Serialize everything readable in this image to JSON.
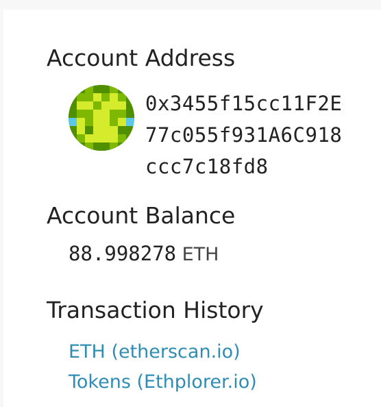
{
  "account_address": {
    "heading": "Account Address",
    "address_lines": [
      "0x3455f15cc11F2E",
      "77c055f931A6C918",
      "ccc7c18fd8"
    ],
    "identicon": {
      "icon": "identicon-avatar",
      "colors": {
        "background": "#2e7d1e",
        "dark": "#4f8f00",
        "mid": "#7fb800",
        "light": "#d4ec2b",
        "spot": "#5bc8e8"
      }
    }
  },
  "account_balance": {
    "heading": "Account Balance",
    "value": "88.998278",
    "unit": "ETH"
  },
  "transaction_history": {
    "heading": "Transaction History",
    "links": [
      {
        "label": "ETH (etherscan.io)"
      },
      {
        "label": "Tokens (Ethplorer.io)"
      }
    ],
    "link_color": "#2f8cb3"
  }
}
